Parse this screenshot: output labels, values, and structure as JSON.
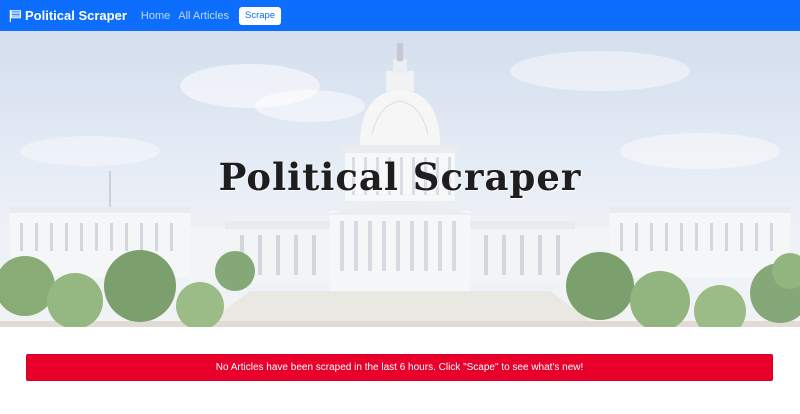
{
  "navbar": {
    "brand": "Political Scraper",
    "brand_icon": "flag-icon",
    "links": [
      "Home",
      "All Articles"
    ],
    "scrape_button": "Scrape",
    "color": "#0d6efd"
  },
  "hero": {
    "title": "Political Scraper",
    "image": "us-capitol-building"
  },
  "alert": {
    "message": "No Articles have been scraped in the last 6 hours. Click \"Scape\" to see what's new!",
    "color": "#e8002b"
  }
}
